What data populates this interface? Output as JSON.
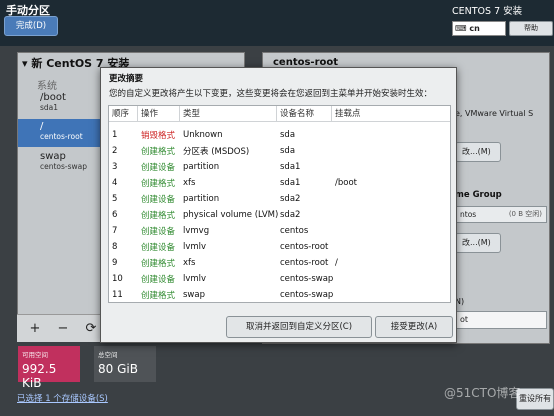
{
  "header": {
    "title": "手动分区",
    "done_button": "完成(D)",
    "install_title": "CENTOS 7 安装",
    "keyboard_layout": "cn",
    "help_button": "帮助"
  },
  "left_panel": {
    "heading": "新 CentOS 7 安装",
    "system_label": "系统",
    "partitions": [
      {
        "name": "/boot",
        "device": "sda1"
      },
      {
        "name": "/",
        "device": "centos-root"
      },
      {
        "name": "swap",
        "device": "centos-swap"
      }
    ],
    "tools": {
      "add": "+",
      "remove": "−",
      "configure": "⟳"
    }
  },
  "space": {
    "available_label": "可用空间",
    "available_value": "992.5 KiB",
    "total_label": "总空间",
    "total_value": "80 GiB"
  },
  "storage_link": "已选择 1 个存储设备(S)",
  "right_panel": {
    "title": "centos-root",
    "device_text": "e, VMware Virtual S",
    "modify_button": "改...(M)",
    "vg_heading": "me Group",
    "vg_value": "ntos",
    "vg_free": "(0 B 空闲)",
    "modify_vg_button": "改...(M)",
    "name_label": "N)",
    "name_value": "ot"
  },
  "bottom_right_button": "重设所有",
  "watermark": "@51CTO博客",
  "modal": {
    "title": "更改摘要",
    "description": "您的自定义更改将产生以下变更，这些变更将会在您返回到主菜单并开始安装时生效：",
    "columns": {
      "order": "顺序",
      "action": "操作",
      "type": "类型",
      "device": "设备名称",
      "mount": "挂载点"
    },
    "rows": [
      {
        "no": "1",
        "action": "销毁格式",
        "type": "Unknown",
        "device": "sda",
        "mount": ""
      },
      {
        "no": "2",
        "action": "创建格式",
        "type": "分区表 (MSDOS)",
        "device": "sda",
        "mount": ""
      },
      {
        "no": "3",
        "action": "创建设备",
        "type": "partition",
        "device": "sda1",
        "mount": ""
      },
      {
        "no": "4",
        "action": "创建格式",
        "type": "xfs",
        "device": "sda1",
        "mount": "/boot"
      },
      {
        "no": "5",
        "action": "创建设备",
        "type": "partition",
        "device": "sda2",
        "mount": ""
      },
      {
        "no": "6",
        "action": "创建格式",
        "type": "physical volume (LVM)",
        "device": "sda2",
        "mount": ""
      },
      {
        "no": "7",
        "action": "创建设备",
        "type": "lvmvg",
        "device": "centos",
        "mount": ""
      },
      {
        "no": "8",
        "action": "创建设备",
        "type": "lvmlv",
        "device": "centos-root",
        "mount": ""
      },
      {
        "no": "9",
        "action": "创建格式",
        "type": "xfs",
        "device": "centos-root",
        "mount": "/"
      },
      {
        "no": "10",
        "action": "创建设备",
        "type": "lvmlv",
        "device": "centos-swap",
        "mount": ""
      },
      {
        "no": "11",
        "action": "创建格式",
        "type": "swap",
        "device": "centos-swap",
        "mount": ""
      }
    ],
    "cancel_button": "取消并返回到自定义分区(C)",
    "accept_button": "接受更改(A)"
  },
  "colors": {
    "destroy": "#cc1f1f",
    "create": "#2f8a2f",
    "selection": "#3f74b7",
    "available_space": "#c1305e"
  }
}
